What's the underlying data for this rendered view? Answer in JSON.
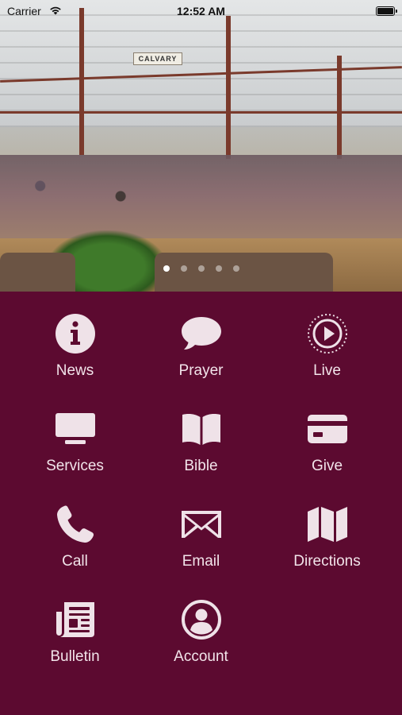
{
  "status_bar": {
    "carrier": "Carrier",
    "time": "12:52 AM"
  },
  "hero": {
    "sign_text": "CALVARY",
    "page_count": 5,
    "active_page": 0
  },
  "menu": [
    {
      "label": "News",
      "icon": "info-icon"
    },
    {
      "label": "Prayer",
      "icon": "speech-bubble-icon"
    },
    {
      "label": "Live",
      "icon": "play-circle-icon"
    },
    {
      "label": "Services",
      "icon": "monitor-icon"
    },
    {
      "label": "Bible",
      "icon": "open-book-icon"
    },
    {
      "label": "Give",
      "icon": "credit-card-icon"
    },
    {
      "label": "Call",
      "icon": "phone-icon"
    },
    {
      "label": "Email",
      "icon": "envelope-icon"
    },
    {
      "label": "Directions",
      "icon": "map-icon"
    },
    {
      "label": "Bulletin",
      "icon": "newspaper-icon"
    },
    {
      "label": "Account",
      "icon": "user-circle-icon"
    }
  ],
  "colors": {
    "background": "#5c0a30",
    "icon": "#efe2e8",
    "label": "#f2e4ea"
  }
}
